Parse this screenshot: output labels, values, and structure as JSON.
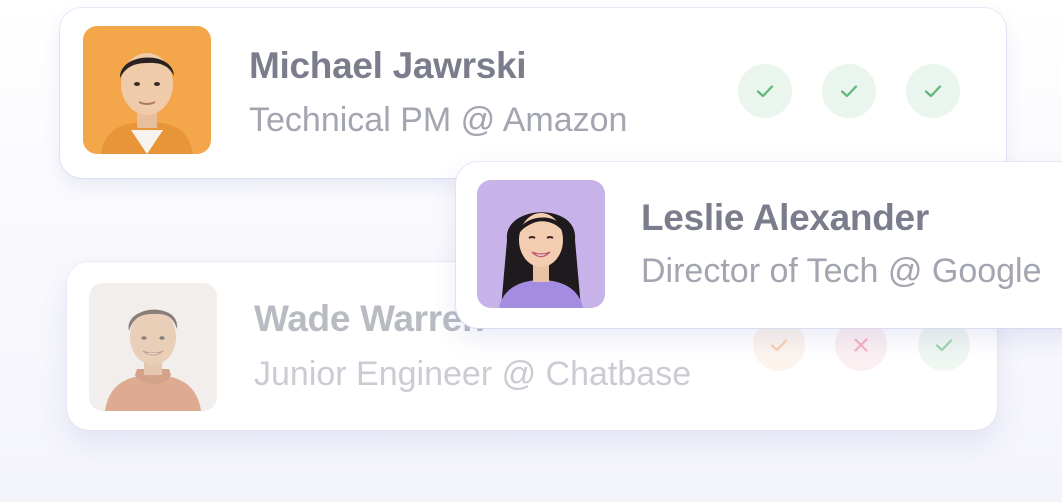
{
  "cards": [
    {
      "name": "Michael Jawrski",
      "role": "Technical PM @ Amazon",
      "photo_bg": "#f4a64b",
      "status": [
        "check",
        "check",
        "check"
      ]
    },
    {
      "name": "Leslie Alexander",
      "role": "Director of Tech @ Google",
      "photo_bg": "#c7b3ea",
      "status": []
    },
    {
      "name": "Wade Warren",
      "role": "Junior Engineer @ Chatbase",
      "photo_bg": "#e9e4e1",
      "status": [
        "check",
        "cross",
        "check"
      ]
    }
  ],
  "colors": {
    "check_green": "#5fb878",
    "check_orange": "#f0b07a",
    "cross_red": "#ef7f94",
    "name_text": "#7b7d8c",
    "role_text": "#a3a5b0"
  },
  "icons": {
    "check": "check-icon",
    "cross": "close-icon"
  }
}
